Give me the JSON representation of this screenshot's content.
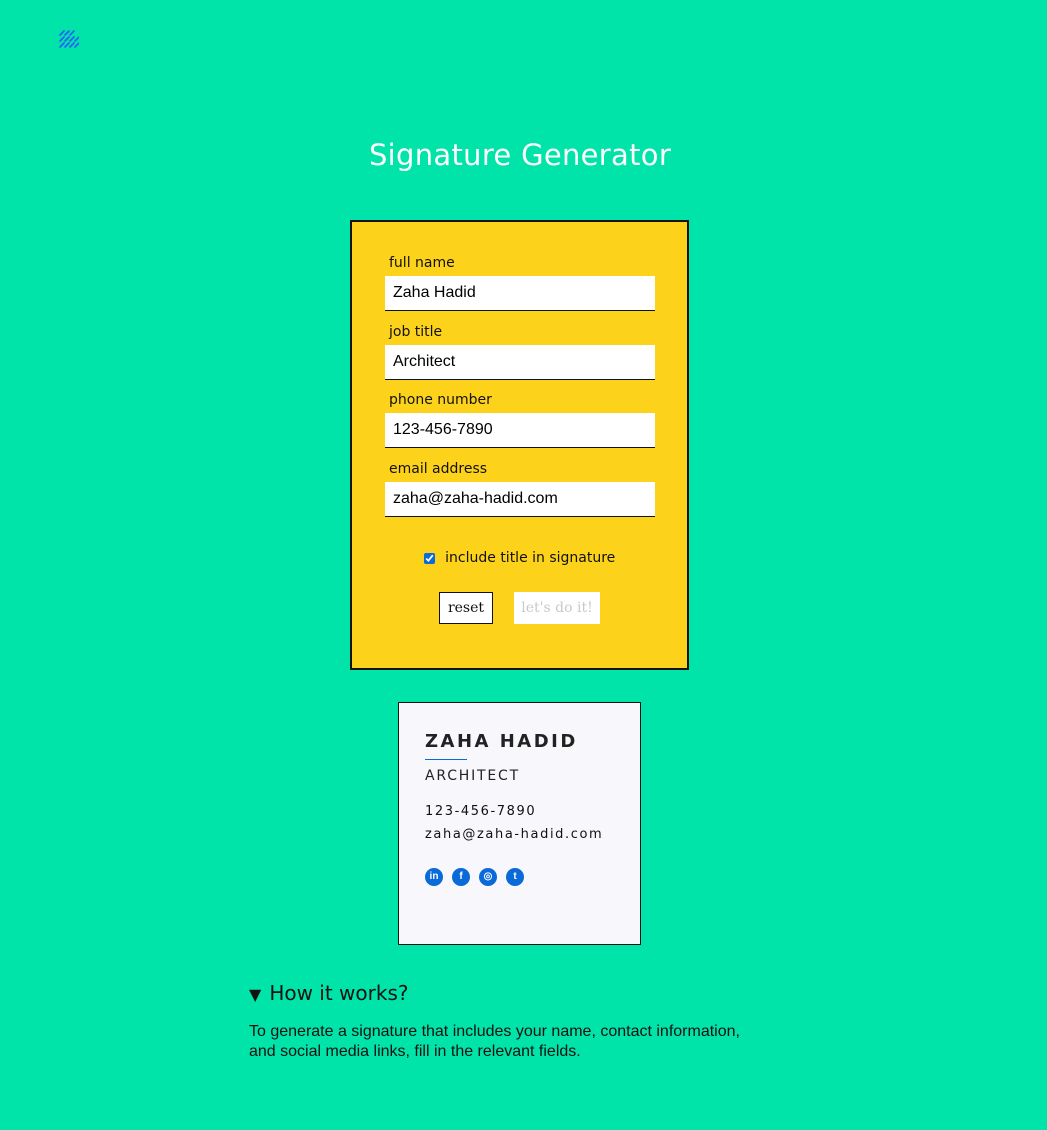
{
  "header": {
    "logo_icon": "diagonal-stripes-logo-icon",
    "title": "Signature Generator"
  },
  "form": {
    "fields": [
      {
        "label": "full name",
        "value": "Zaha Hadid"
      },
      {
        "label": "job title",
        "value": "Architect"
      },
      {
        "label": "phone number",
        "value": "123-456-7890"
      },
      {
        "label": "email address",
        "value": "zaha@zaha-hadid.com"
      }
    ],
    "include_title": {
      "label": "include title in signature",
      "checked": true
    },
    "reset_label": "reset",
    "submit_label": "let's do it!"
  },
  "preview": {
    "name": "ZAHA HADID",
    "title": "ARCHITECT",
    "phone": "123-456-7890",
    "email": "zaha@zaha-hadid.com",
    "social": [
      {
        "icon": "linkedin-icon",
        "glyph": "in"
      },
      {
        "icon": "facebook-icon",
        "glyph": "f"
      },
      {
        "icon": "instagram-icon",
        "glyph": "◎"
      },
      {
        "icon": "twitter-icon",
        "glyph": "t"
      }
    ]
  },
  "how_it_works": {
    "summary": "How it works?",
    "text": "To generate a signature that includes your name, contact information, and social media links, fill in the relevant fields."
  },
  "colors": {
    "background": "#00e3a9",
    "form_card": "#fdd21b",
    "accent": "#0a6ad7"
  }
}
